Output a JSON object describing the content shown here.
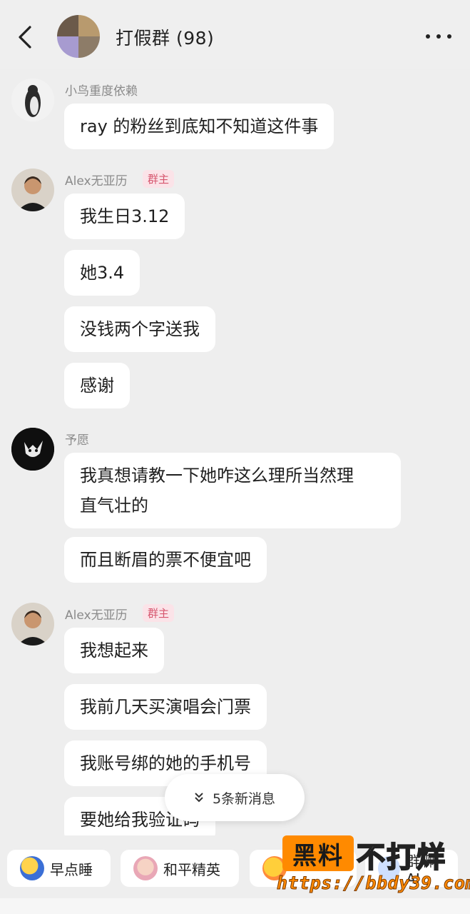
{
  "header": {
    "title": "打假群 (98)"
  },
  "messages": [
    {
      "sender": "小鸟重度依赖",
      "avatar": "penguin-avatar",
      "bubbles": [
        "ray 的粉丝到底知不知道这件事"
      ]
    },
    {
      "sender": "Alex无亚历",
      "badge": "群主",
      "avatar": "alex-avatar",
      "bubbles": [
        "我生日3.12",
        "她3.4",
        "没钱两个字送我",
        "感谢"
      ]
    },
    {
      "sender": "予愿",
      "avatar": "cat-avatar",
      "bubbles": [
        "我真想请教一下她咋这么理所当然理\n直气壮的",
        "而且断眉的票不便宜吧"
      ]
    },
    {
      "sender": "Alex无亚历",
      "badge": "群主",
      "avatar": "alex-avatar",
      "bubbles": [
        "我想起来",
        "我前几天买演唱会门票",
        "我账号绑的她的手机号",
        "要她给我验证码"
      ]
    }
  ],
  "new_messages": {
    "label": "5条新消息",
    "icon": "chevron-double-down-icon"
  },
  "quick_actions": [
    {
      "label": "早点睡",
      "icon": "moon-sleep-icon"
    },
    {
      "label": "和平精英",
      "icon": "game-character-icon"
    },
    {
      "label": "",
      "icon": "duck-icon"
    },
    {
      "label": "群聊AI",
      "icon": "ai-icon"
    }
  ],
  "watermark": {
    "box": "黑料",
    "text": "不打烊",
    "url": "https://bbdy39.com"
  },
  "colors": {
    "background": "#eeeeee",
    "bubble": "#ffffff",
    "badge_text": "#d6566e",
    "badge_bg": "#fbe3e8",
    "watermark_orange": "#ff8a00"
  }
}
